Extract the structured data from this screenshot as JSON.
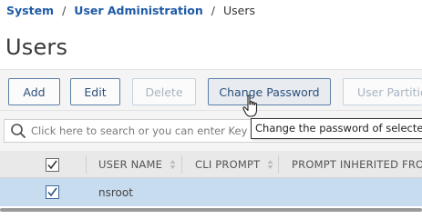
{
  "breadcrumb": {
    "items": [
      "System",
      "User Administration"
    ],
    "separator": "/",
    "current": "Users"
  },
  "page": {
    "title": "Users"
  },
  "toolbar": {
    "add_label": "Add",
    "edit_label": "Edit",
    "delete_label": "Delete",
    "change_password_label": "Change Password",
    "user_partitions_label": "User Partitio"
  },
  "search": {
    "placeholder": "Click here to search or you can enter Key : Va",
    "icon": "search-icon"
  },
  "tooltip": {
    "text": "Change the password of selected sy"
  },
  "table": {
    "columns": [
      "USER NAME",
      "CLI PROMPT",
      "PROMPT INHERITED FROM"
    ],
    "rows": [
      {
        "user_name": "nsroot",
        "cli_prompt": "",
        "prompt_inherited_from": "",
        "selected": true
      }
    ],
    "select_all_checked": true
  },
  "colors": {
    "link": "#1f5aa6",
    "button_border": "#5b7fa8",
    "selected_row": "#c8dcef",
    "header_bg": "#e9e9e9"
  }
}
